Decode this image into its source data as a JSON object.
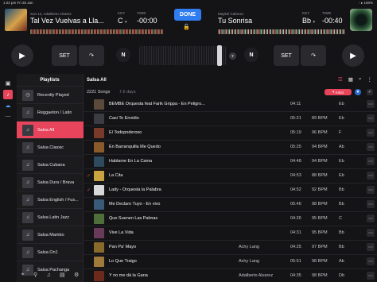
{
  "status_bar": {
    "time": "1:22 pm  Fri 26 Jan",
    "right": "◦ ▸ 100%"
  },
  "deck_a": {
    "artist": "Son 14, Adalberto Alvarez",
    "title": "Tal Vez Vuelvas a Lla...",
    "key_label": "KEY",
    "key_value": "C",
    "time_label": "TIME",
    "time_value": "-00:00"
  },
  "deck_b": {
    "artist": "Maykel Cabrera",
    "title": "Tu Sonrisa",
    "key_label": "KEY",
    "key_value": "Bb",
    "time_label": "TIME",
    "time_value": "-00:40"
  },
  "center": {
    "done_label": "DONE"
  },
  "transport": {
    "set_label": "SET",
    "n_label": "N"
  },
  "playlists": {
    "header": "Playlists",
    "items": [
      {
        "label": "Recently Played",
        "icon": "clock-icon"
      },
      {
        "label": "Reggaeton / Latin",
        "icon": "playlist-icon"
      },
      {
        "label": "Salsa All",
        "icon": "playlist-icon",
        "active": true
      },
      {
        "label": "Salsa Classic",
        "icon": "playlist-icon"
      },
      {
        "label": "Salsa Cubana",
        "icon": "playlist-icon"
      },
      {
        "label": "Salsa Dura / Brava",
        "icon": "playlist-icon"
      },
      {
        "label": "Salsa English / Fus...",
        "icon": "playlist-icon"
      },
      {
        "label": "Salsa Latin Jazz",
        "icon": "playlist-icon"
      },
      {
        "label": "Salsa Mambo",
        "icon": "playlist-icon"
      },
      {
        "label": "Salsa On1",
        "icon": "playlist-icon"
      },
      {
        "label": "Salsa Pachanga",
        "icon": "playlist-icon"
      }
    ]
  },
  "track_list": {
    "header": "Salsa All",
    "count": "2221 Songs",
    "duration": "7.6 days",
    "sort_label": "Artist",
    "rows": [
      {
        "title": "BEMBE Orquesta feat Farik Grippa - En Peligro...",
        "artist": "",
        "duration": "04:11",
        "bpm": "",
        "key": "Eb",
        "checked": false,
        "cover": "#5b4a3b"
      },
      {
        "title": "Casi Te Envidio",
        "artist": "",
        "duration": "05:21",
        "bpm": "89 BPM",
        "key": "Eb",
        "checked": false,
        "cover": "#3b3b44"
      },
      {
        "title": "El Todopoderoso",
        "artist": "",
        "duration": "05:19",
        "bpm": "96 BPM",
        "key": "F",
        "checked": false,
        "cover": "#7a3a2a"
      },
      {
        "title": "En Barranquilla Me Quedo",
        "artist": "",
        "duration": "05:25",
        "bpm": "94 BPM",
        "key": "Ab",
        "checked": false,
        "cover": "#8a5a2a"
      },
      {
        "title": "Hablame En La Cama",
        "artist": "",
        "duration": "04:48",
        "bpm": "94 BPM",
        "key": "Eb",
        "checked": false,
        "cover": "#2e4a5e"
      },
      {
        "title": "La Cita",
        "artist": "",
        "duration": "04:53",
        "bpm": "88 BPM",
        "key": "Eb",
        "checked": true,
        "cover": "#c9a340"
      },
      {
        "title": "Lady - Orquesta la Palabra",
        "artist": "",
        "duration": "04:52",
        "bpm": "92 BPM",
        "key": "Bb",
        "checked": true,
        "cover": "#d8d8d8"
      },
      {
        "title": "Me Declaro Tuyo - En vivo",
        "artist": "",
        "duration": "05:46",
        "bpm": "98 BPM",
        "key": "Bb",
        "checked": false,
        "cover": "#3a5a7a"
      },
      {
        "title": "Que Suenen Las Palmas",
        "artist": "",
        "duration": "04:26",
        "bpm": "95 BPM",
        "key": "C",
        "checked": false,
        "cover": "#4e6e3a"
      },
      {
        "title": "Vive La Vida",
        "artist": "",
        "duration": "04:31",
        "bpm": "95 BPM",
        "key": "Bb",
        "checked": false,
        "cover": "#6a3a5a"
      },
      {
        "title": "Pan Pa' Mayo",
        "artist": "Achy Lang",
        "duration": "04:25",
        "bpm": "97 BPM",
        "key": "Bb",
        "checked": false,
        "cover": "#8a6a2a"
      },
      {
        "title": "Lo Que Traigo",
        "artist": "Achy Lang",
        "duration": "05:51",
        "bpm": "98 BPM",
        "key": "Ab",
        "checked": false,
        "cover": "#a07a3a"
      },
      {
        "title": "Y no me dá la Gana",
        "artist": "Adalberto Alvarez",
        "duration": "04:35",
        "bpm": "98 BPM",
        "key": "Db",
        "checked": false,
        "cover": "#6b2a1c"
      }
    ]
  }
}
